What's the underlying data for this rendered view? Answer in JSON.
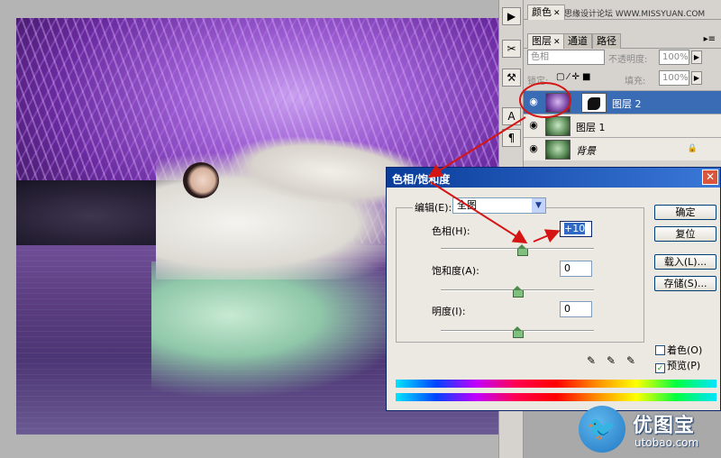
{
  "panels": {
    "top_tabs": {
      "color": "颜色",
      "watermark": "思缘设计论坛 WWW.MISSYUAN.COM"
    },
    "layer_tabs": {
      "layers": "图层",
      "channels": "通道",
      "paths": "路径"
    },
    "blend_mode": "色相",
    "opacity_label": "不透明度:",
    "opacity_value": "100%",
    "lock_label": "锁定:",
    "fill_label": "填充:",
    "fill_value": "100%",
    "layers": [
      {
        "name": "图层 2",
        "selected": true
      },
      {
        "name": "图层 1",
        "selected": false
      },
      {
        "name": "背景",
        "selected": false
      }
    ]
  },
  "dialog": {
    "title": "色相/饱和度",
    "edit_label": "编辑(E):",
    "edit_value": "全图",
    "hue_label": "色相(H):",
    "hue_value": "+10",
    "saturation_label": "饱和度(A):",
    "saturation_value": "0",
    "lightness_label": "明度(I):",
    "lightness_value": "0",
    "hue_slider_fraction": 0.5278,
    "saturation_slider_fraction": 0.5,
    "lightness_slider_fraction": 0.5,
    "buttons": {
      "ok": "确定",
      "reset": "复位",
      "load": "载入(L)...",
      "save": "存储(S)..."
    },
    "colorize_label": "着色(O)",
    "colorize_checked": false,
    "preview_label": "预览(P)",
    "preview_checked": true
  },
  "brand": {
    "name": "优图宝",
    "url": "utobao.com"
  }
}
